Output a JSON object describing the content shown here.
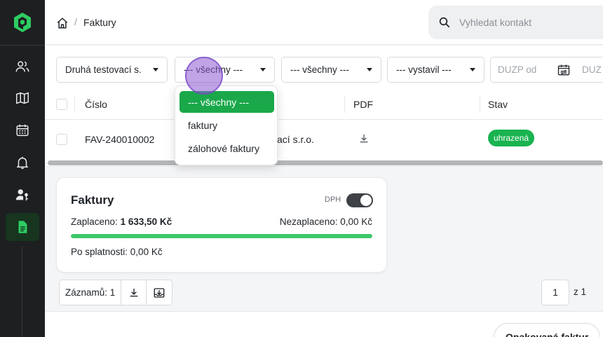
{
  "colors": {
    "accent": "#1aa84a",
    "sidebar_bg": "#1d1f21",
    "badge_paid": "#19b350",
    "progress": "#3cc76a"
  },
  "sidebar": {
    "logo": "app-logo",
    "items": [
      {
        "icon": "users-icon",
        "active": false
      },
      {
        "icon": "map-icon",
        "active": false
      },
      {
        "icon": "calendar-icon",
        "active": false
      },
      {
        "icon": "bell-icon",
        "active": false
      },
      {
        "icon": "user-key-icon",
        "active": false
      },
      {
        "icon": "document-icon",
        "active": true
      }
    ]
  },
  "header": {
    "breadcrumb_sep": "/",
    "breadcrumb_current": "Faktury",
    "search_placeholder": "Vyhledat kontakt"
  },
  "filters": {
    "company": "Druhá testovací s.",
    "type": "--- všechny ---",
    "status": "--- všechny ---",
    "issuer": "--- vystavil ---",
    "duzp_from_placeholder": "DUZP od",
    "duzp_to_placeholder": "DUZ"
  },
  "table": {
    "columns": [
      "Číslo",
      "PDF",
      "Stav"
    ],
    "rows": [
      {
        "number": "FAV-240010002",
        "customer_fragment": "ací s.r.o.",
        "status": "uhrazená"
      }
    ]
  },
  "dropdown": {
    "options": [
      "--- všechny ---",
      "faktury",
      "zálohové faktury"
    ],
    "selected": 0
  },
  "summary": {
    "title": "Faktury",
    "dph_label": "DPH",
    "dph_on": true,
    "paid_label": "Zaplaceno:",
    "paid_value": "1 633,50 Kč",
    "unpaid_text": "Nezaplaceno: 0,00 Kč",
    "overdue_text": "Po splatnosti: 0,00 Kč",
    "paid_fraction": 1.0
  },
  "footer": {
    "records_label": "Záznamů: 1",
    "page_current": "1",
    "page_of": "z 1",
    "bottom_button": "Opakovaná faktur"
  }
}
